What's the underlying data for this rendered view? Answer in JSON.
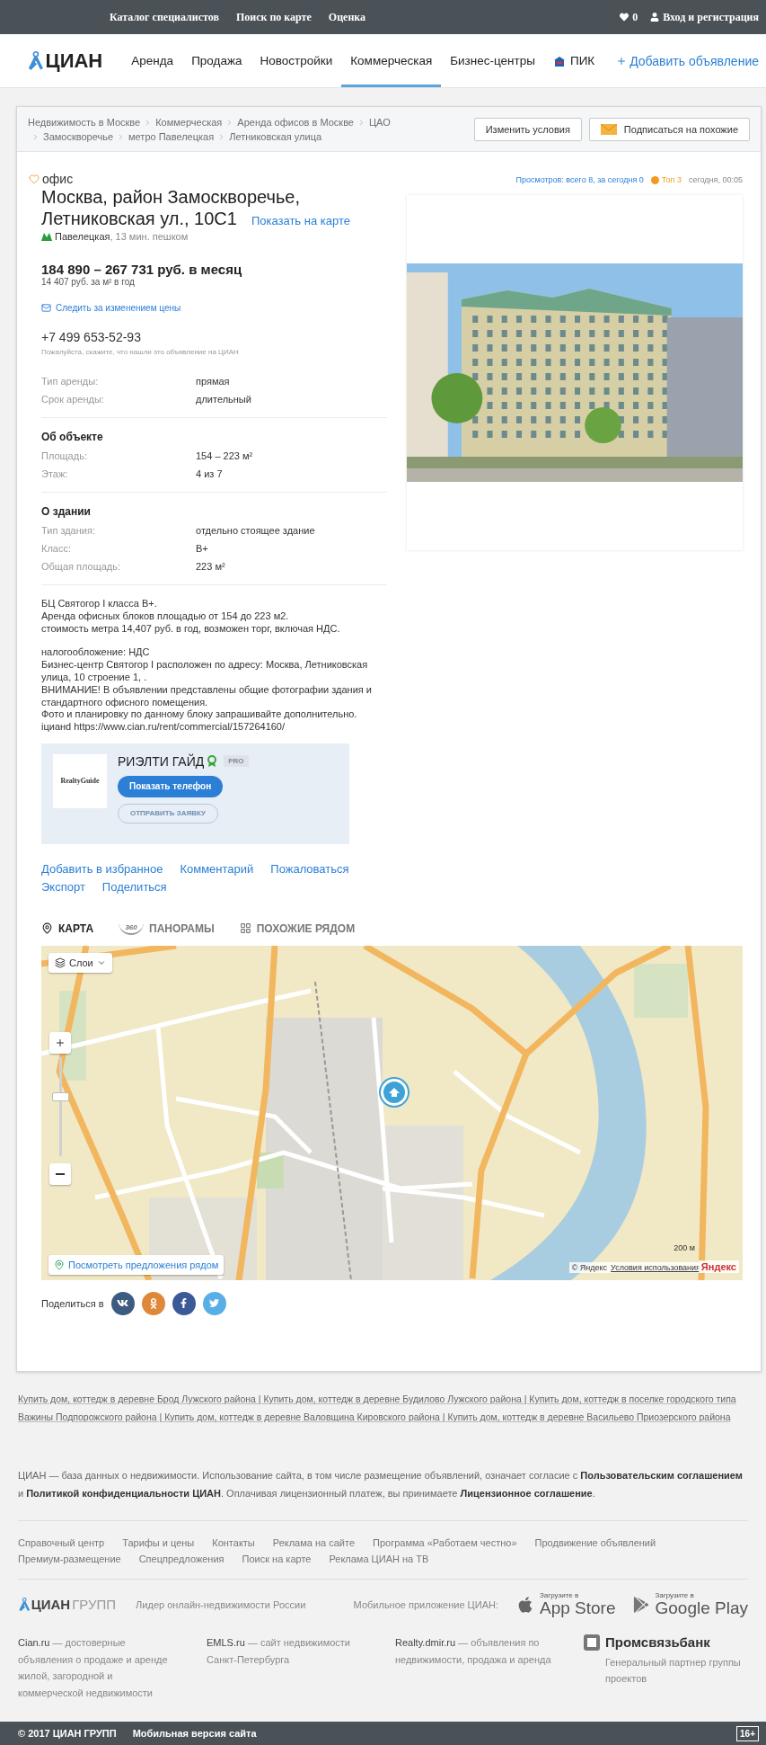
{
  "top_bar": {
    "links": [
      "Каталог специалистов",
      "Поиск по карте",
      "Оценка"
    ],
    "favorites_count": "0",
    "login": "Вход и регистрация"
  },
  "nav": {
    "logo": "ЦИАН",
    "items": [
      {
        "label": "Аренда",
        "selected": false,
        "kind": "plain"
      },
      {
        "label": "Продажа",
        "selected": false,
        "kind": "plain"
      },
      {
        "label": "Новостройки",
        "selected": false,
        "kind": "plain"
      },
      {
        "label": "Коммерческая",
        "selected": true,
        "kind": "plain"
      },
      {
        "label": "Бизнес-центры",
        "selected": false,
        "kind": "plain"
      },
      {
        "label": "ПИК",
        "selected": false,
        "kind": "brand"
      }
    ],
    "add_listing": "Добавить объявление"
  },
  "breadcrumbs": [
    "Недвижимость в Москве",
    "Коммерческая",
    "Аренда офисов в Москве",
    "ЦАО",
    "Замоскворечье",
    "метро Павелецкая",
    "Летниковская улица"
  ],
  "search_actions": [
    {
      "label": "Изменить условия",
      "kind": "plain"
    },
    {
      "label": "Подписаться на похожие",
      "kind": "mail"
    }
  ],
  "listing": {
    "type": "офис",
    "views": "Просмотров: всего 8, за сегодня 0",
    "top": "Топ 3",
    "date": "сегодня, 00:05",
    "address_lines": [
      "Москва, район Замоскворечье,",
      "Летниковская ул., 10С1"
    ],
    "show_on_map": "Показать на карте",
    "metro": {
      "station": "Павелецкая",
      "walk": ", 13 мин. пешком"
    },
    "price": "184 890 – 267 731 руб. в месяц",
    "price_per_m2": "14 407 руб. за м² в год",
    "watch_price": "Следить за изменением цены",
    "phone": "+7 499 653-52-93",
    "phone_note": "Пожалуйста, скажите, что нашли это объявление на ЦИАН",
    "terms": [
      {
        "label": "Тип аренды:",
        "value": "прямая"
      },
      {
        "label": "Срок аренды:",
        "value": "длительный"
      }
    ],
    "sections": [
      {
        "title": "Об объекте",
        "rows": [
          {
            "label": "Площадь:",
            "value": "154 – 223 м²"
          },
          {
            "label": "Этаж:",
            "value": "4 из 7"
          }
        ]
      },
      {
        "title": "О здании",
        "rows": [
          {
            "label": "Тип здания:",
            "value": "отдельно стоящее здание"
          },
          {
            "label": "Класс:",
            "value": "B+"
          },
          {
            "label": "Общая площадь:",
            "value": "223 м²"
          }
        ]
      }
    ],
    "description": [
      [
        "БЦ Святогор I класса В+.",
        "Аренда офисных блоков площадью от 154 до 223 м2.",
        "стоимость метра 14,407 руб. в год, возможен торг, включая НДС."
      ],
      [
        "налогообложение: НДС",
        "Бизнес-центр Святогор I расположен по адресу: Москва, Летниковская",
        "улица, 10 строение 1, .",
        "ВНИМАНИЕ! В объявлении представлены общие фотографии здания и",
        "стандартного офисного помещения.",
        "Фото и планировку по данному блоку запрашивайте дополнительно.",
        "iцианd https://www.cian.ru/rent/commercial/157264160/"
      ]
    ]
  },
  "agent": {
    "logo": "RealtyGuide",
    "name": "РИЭЛТИ ГАЙД",
    "badge": "PRO",
    "show_phone": "Показать телефон",
    "send_request": "ОТПРАВИТЬ ЗАЯВКУ"
  },
  "listing_links": [
    "Добавить в избранное",
    "Комментарий",
    "Пожаловаться",
    "Экспорт",
    "Поделиться"
  ],
  "map_tabs": [
    {
      "label": "КАРТА",
      "selected": true,
      "kind": "pin"
    },
    {
      "label": "ПАНОРАМЫ",
      "selected": false,
      "kind": "panorama",
      "icon_text": "360"
    },
    {
      "label": "ПОХОЖИЕ РЯДОМ",
      "selected": false,
      "kind": "grid"
    }
  ],
  "map": {
    "layers": "Слои",
    "nearby": "Посмотреть предложения рядом",
    "scale": "200 м",
    "copyright": "© Яндекс",
    "terms": "Условия использования",
    "brand": "Яндекс"
  },
  "share": {
    "label": "Поделиться в",
    "networks": [
      {
        "kind": "vk",
        "color": "#3d5a80"
      },
      {
        "kind": "ok",
        "color": "#e0883a"
      },
      {
        "kind": "fb",
        "color": "#3b5998"
      },
      {
        "kind": "tw",
        "color": "#5aaee8"
      }
    ]
  },
  "seo_links": "Купить дом, коттедж в деревне Брод Лужского района | Купить дом, коттедж в деревне Будилово Лужского района | Купить дом, коттедж в поселке городского типа Важины Подпорожского района | Купить дом, коттедж в деревне Валовщина Кировского района | Купить дом, коттедж в деревне Васильево Приозерского района",
  "legal": "ЦИАН — база данных о недвижимости. Использование сайта, в том числе размещение объявлений, означает согласие с **Пользовательским соглашением** и **Политикой конфиденциальности ЦИАН**. Оплачивая лицензионный платеж, вы принимаете **Лицензионное соглашение**.",
  "footer_links": [
    "Справочный центр",
    "Тарифы и цены",
    "Контакты",
    "Реклама на сайте",
    "Программа «Работаем честно»",
    "Продвижение объявлений",
    "Премиум-размещение",
    "Спецпредложения",
    "Поиск на карте",
    "Реклама ЦИАН на ТВ"
  ],
  "footer": {
    "logo": "ЦИАН",
    "logo_suffix": "ГРУПП",
    "tagline": "Лидер онлайн-недвижимости России",
    "app_label": "Мобильное приложение ЦИАН:",
    "stores": [
      {
        "kind": "apple",
        "small": "Загрузите в",
        "name": "App Store"
      },
      {
        "kind": "google",
        "small": "Загрузите в",
        "name": "Google Play"
      }
    ],
    "projects": [
      {
        "name": "Cian.ru",
        "text": " — достоверные объявления о продаже и аренде жилой, загородной и коммерческой недвижимости"
      },
      {
        "name": "EMLS.ru",
        "text": " — сайт недвижимости Санкт-Петербурга"
      },
      {
        "name": "Realty.dmir.ru",
        "text": " — объявления по недвижимости, продажа и аренда"
      }
    ],
    "partner": {
      "name": "Промсвязьбанк",
      "text": "Генеральный партнер группы проектов"
    }
  },
  "bottom_bar": {
    "copyright": "© 2017 ЦИАН ГРУПП",
    "mobile": "Мобильная версия сайта",
    "age": "16+"
  }
}
